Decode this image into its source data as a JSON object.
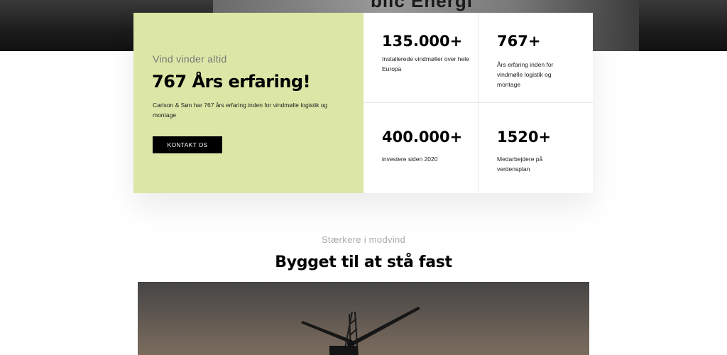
{
  "hero": {
    "sign_text": "blic Energi"
  },
  "intro": {
    "subtitle": "Vind vinder altid",
    "title": "767 Års erfaring!",
    "text": "Carlson & Søn har 767 års erfaring inden for vindmølle logistik og montage",
    "button_label": "KONTAKT OS"
  },
  "stats": [
    {
      "number": "135.000+",
      "label": "Installerede vindmøller over hele Europa"
    },
    {
      "number": "767+",
      "label": "Års erfaring inden for vindmølle logistik og montage"
    },
    {
      "number": "400.000+",
      "label": "investere siden 2020"
    },
    {
      "number": "1520+",
      "label": "Medarbejdere på verdensplan"
    }
  ],
  "section": {
    "subtitle": "Stærkere i modvind",
    "title": "Bygget til at stå fast"
  }
}
